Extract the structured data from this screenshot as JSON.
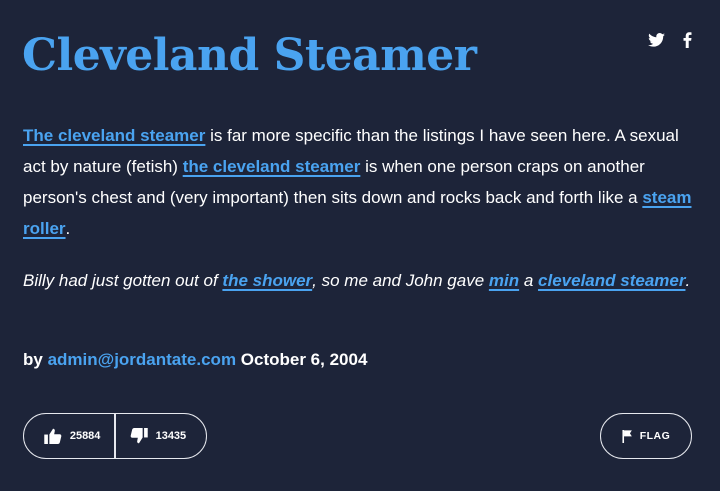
{
  "definition": {
    "word": "Cleveland Steamer",
    "share": {
      "twitter_icon": "twitter-bird-icon",
      "facebook_icon": "facebook-f-icon"
    },
    "meaning": {
      "link_1": "The cleveland steamer",
      "text_1": " is far more specific than the listings I have seen here. A sexual act by nature (fetish) ",
      "link_2": "the cleveland steamer",
      "text_2": " is when one person craps on another person's chest and (very important) then sits down and rocks back and forth like a ",
      "link_3": "steam roller",
      "text_3": "."
    },
    "example": {
      "text_1": "Billy had just gotten out of ",
      "link_1": "the shower",
      "text_2": ", so me and John gave ",
      "link_2": "min",
      "text_3": " a ",
      "link_3": "cleveland steamer",
      "text_4": "."
    },
    "contributor": {
      "by_label": "by ",
      "author": "admin@jordantate.com",
      "date": " October 6, 2004"
    },
    "votes": {
      "thumbs_up_icon": "thumbs-up-icon",
      "up_count": "25884",
      "thumbs_down_icon": "thumbs-down-icon",
      "down_count": "13435"
    },
    "flag": {
      "icon": "flag-icon",
      "label": "FLAG"
    }
  },
  "colors": {
    "background": "#1d2439",
    "accent": "#4aa3f0",
    "text": "#ffffff",
    "border": "#e6e8ee"
  }
}
